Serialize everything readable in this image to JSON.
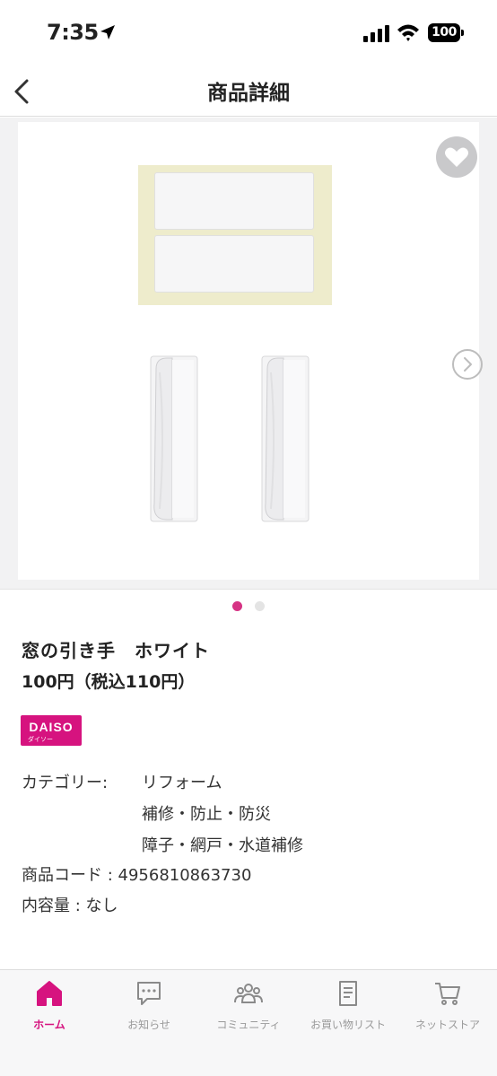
{
  "status_bar": {
    "time": "7:35",
    "battery": "100"
  },
  "header": {
    "title": "商品詳細"
  },
  "carousel": {
    "current_index": 1,
    "total": 2
  },
  "product": {
    "name": "窓の引き手　ホワイト",
    "price": "100円（税込110円）",
    "brand_logo": {
      "main": "DAISO",
      "sub": "ダイソー"
    },
    "category_label": "カテゴリー:",
    "categories": [
      "リフォーム",
      "補修・防止・防災",
      "障子・網戸・水道補修"
    ],
    "code_label": "商品コード : ",
    "code": "4956810863730",
    "capacity_label": "内容量 : ",
    "capacity": "なし"
  },
  "tabs": [
    {
      "label": "ホーム",
      "icon": "home-icon",
      "active": true
    },
    {
      "label": "お知らせ",
      "icon": "chat-bubble-icon",
      "active": false
    },
    {
      "label": "コミュニティ",
      "icon": "people-icon",
      "active": false
    },
    {
      "label": "お買い物リスト",
      "icon": "document-list-icon",
      "active": false
    },
    {
      "label": "ネットストア",
      "icon": "cart-icon",
      "active": false
    }
  ],
  "colors": {
    "accent": "#d6137f",
    "dot_active": "#d63384"
  }
}
